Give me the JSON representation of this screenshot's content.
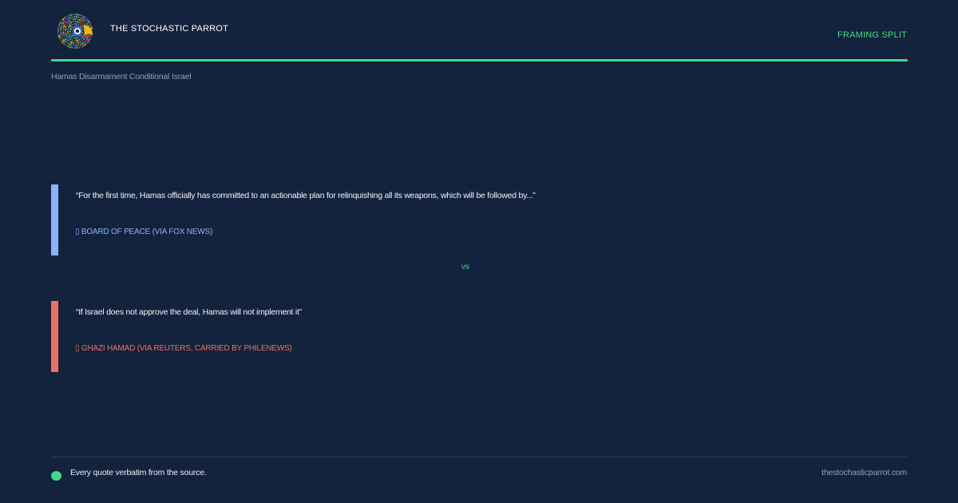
{
  "header": {
    "logo_icon": "parrot-icon",
    "brand": "THE STOCHASTIC PARROT",
    "tag": "FRAMING SPLIT",
    "subtitle": "Hamas Disarmament Conditional Israel"
  },
  "quotes": [
    {
      "text": "“For the first time, Hamas officially has committed to an actionable plan for relinquishing all its weapons, which will be followed by...”",
      "attribution": "▯ BOARD OF PEACE (VIA FOX NEWS)",
      "color": "#8ab4f8"
    },
    {
      "text": "“If Israel does not approve the deal, Hamas will not implement it”",
      "attribution": "▯ GHAZI HAMAD (VIA REUTERS, CARRIED BY PHILENEWS)",
      "color": "#f07162"
    }
  ],
  "separator": "vs",
  "footer": {
    "note": "Every quote verbatim from the source.",
    "site": "thestochasticparrot.com"
  },
  "colors": {
    "background": "#13223d",
    "accent": "#3ddc84",
    "blue": "#8ab4f8",
    "red": "#f07162"
  }
}
